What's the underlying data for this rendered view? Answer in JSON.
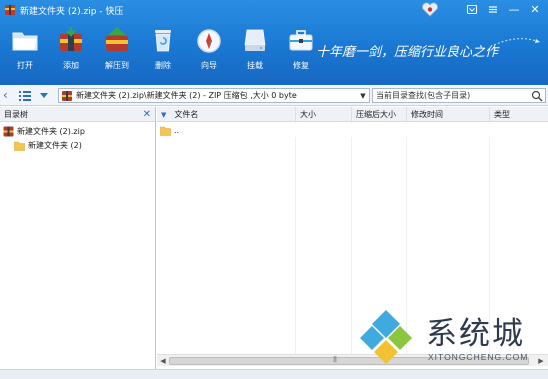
{
  "window": {
    "title": "新建文件夹 (2).zip - 快压",
    "buttons": {
      "minimize": "—",
      "close": "✕"
    }
  },
  "toolbar": {
    "items": [
      {
        "label": "打开",
        "icon": "open-folder-icon"
      },
      {
        "label": "添加",
        "icon": "add-archive-icon"
      },
      {
        "label": "解压到",
        "icon": "extract-archive-icon"
      },
      {
        "label": "删除",
        "icon": "trash-icon"
      },
      {
        "label": "向导",
        "icon": "compass-icon"
      },
      {
        "label": "挂载",
        "icon": "drive-icon"
      },
      {
        "label": "修复",
        "icon": "toolbox-icon"
      }
    ],
    "slogan": "十年磨一剑，压缩行业良心之作"
  },
  "address": {
    "path": "新建文件夹 (2).zip\\新建文件夹 (2) - ZIP 压缩包 ,大小 0 byte",
    "search_placeholder": "当前目录查找(包含子目录)"
  },
  "tree": {
    "title": "目录树",
    "close": "✕",
    "nodes": [
      {
        "label": "新建文件夹 (2).zip",
        "icon": "zip-archive-icon",
        "level": 0
      },
      {
        "label": "新建文件夹 (2)",
        "icon": "folder-icon",
        "level": 1
      }
    ]
  },
  "filelist": {
    "columns": [
      "文件名",
      "大小",
      "压缩后大小",
      "修改时间",
      "类型"
    ],
    "sort_indicator": "▼",
    "rows": [
      {
        "name": "..",
        "icon": "folder-up-icon"
      }
    ]
  },
  "watermark": {
    "title": "系统城",
    "subtitle": "XITONGCHENG.COM"
  },
  "colors": {
    "titlebar": "#1a78d2",
    "accent": "#2a6fc4",
    "header_bg": "#eef2f7"
  }
}
